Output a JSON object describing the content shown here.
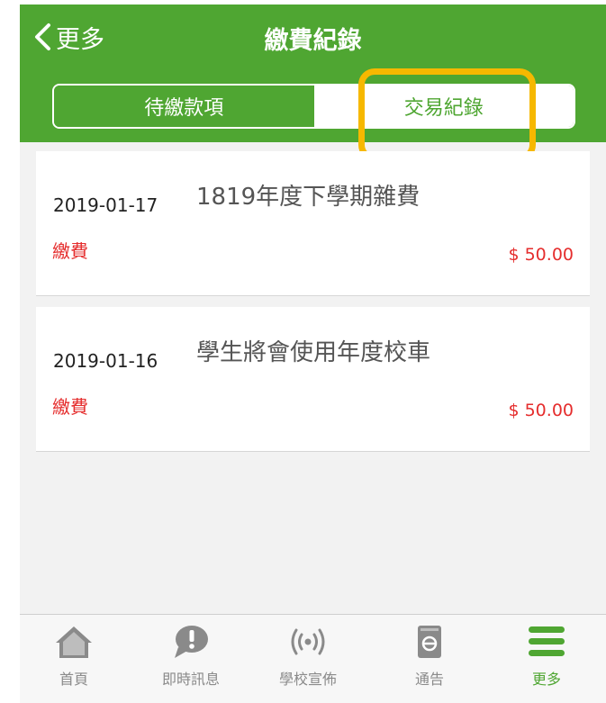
{
  "header": {
    "back_label": "更多",
    "title": "繳費紀錄",
    "tabs": [
      {
        "label": "待繳款項",
        "selected": false
      },
      {
        "label": "交易紀錄",
        "selected": true
      }
    ]
  },
  "records": [
    {
      "date": "2019-01-17",
      "description": "1819年度下學期雜費",
      "status": "繳費",
      "amount": "$ 50.00"
    },
    {
      "date": "2019-01-16",
      "description": "學生將會使用年度校車",
      "status": "繳費",
      "amount": "$ 50.00"
    }
  ],
  "tabbar": {
    "items": [
      {
        "label": "首頁",
        "icon": "home-icon"
      },
      {
        "label": "即時訊息",
        "icon": "message-bubble-icon"
      },
      {
        "label": "學校宣佈",
        "icon": "broadcast-icon"
      },
      {
        "label": "通告",
        "icon": "notice-icon"
      },
      {
        "label": "更多",
        "icon": "menu-icon",
        "active": true
      }
    ]
  },
  "colors": {
    "brand_green": "#4fa632",
    "alert_red": "#e52d2d",
    "highlight": "#f6b800"
  }
}
